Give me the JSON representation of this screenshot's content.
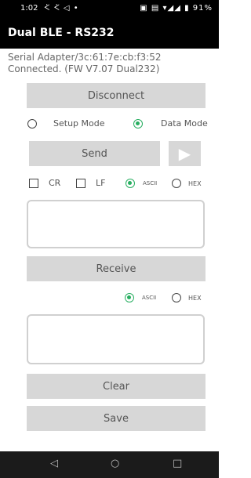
{
  "status_bar": {
    "time": "1:02",
    "status_icons": "ᢵ ᢵ ◁ •",
    "right_icons": "▣ ▤ ▾◢◢ ▮",
    "battery": "91%"
  },
  "app": {
    "title": "Dual BLE - RS232"
  },
  "info": {
    "device": "Serial Adapter/3c:61:7e:cb:f3:52",
    "status": "Connected. (FW V7.07 Dual232)"
  },
  "buttons": {
    "disconnect": "Disconnect",
    "send": "Send",
    "send_arrow": "▶",
    "receive": "Receive",
    "clear": "Clear",
    "save": "Save"
  },
  "mode": {
    "setup": "Setup Mode",
    "data": "Data Mode",
    "selected": "Data Mode"
  },
  "send_options": {
    "cr": "CR",
    "lf": "LF",
    "ascii": "ASCII",
    "hex": "HEX",
    "cr_checked": false,
    "lf_checked": false,
    "format_selected": "ASCII"
  },
  "receive_options": {
    "ascii": "ASCII",
    "hex": "HEX",
    "format_selected": "ASCII"
  },
  "send_text": "",
  "receive_text": "",
  "nav": {
    "back": "◁",
    "home": "○",
    "recents": "□"
  },
  "colors": {
    "accent": "#27ae60",
    "button_bg": "#d7d7d7",
    "bar_bg": "#000000"
  }
}
